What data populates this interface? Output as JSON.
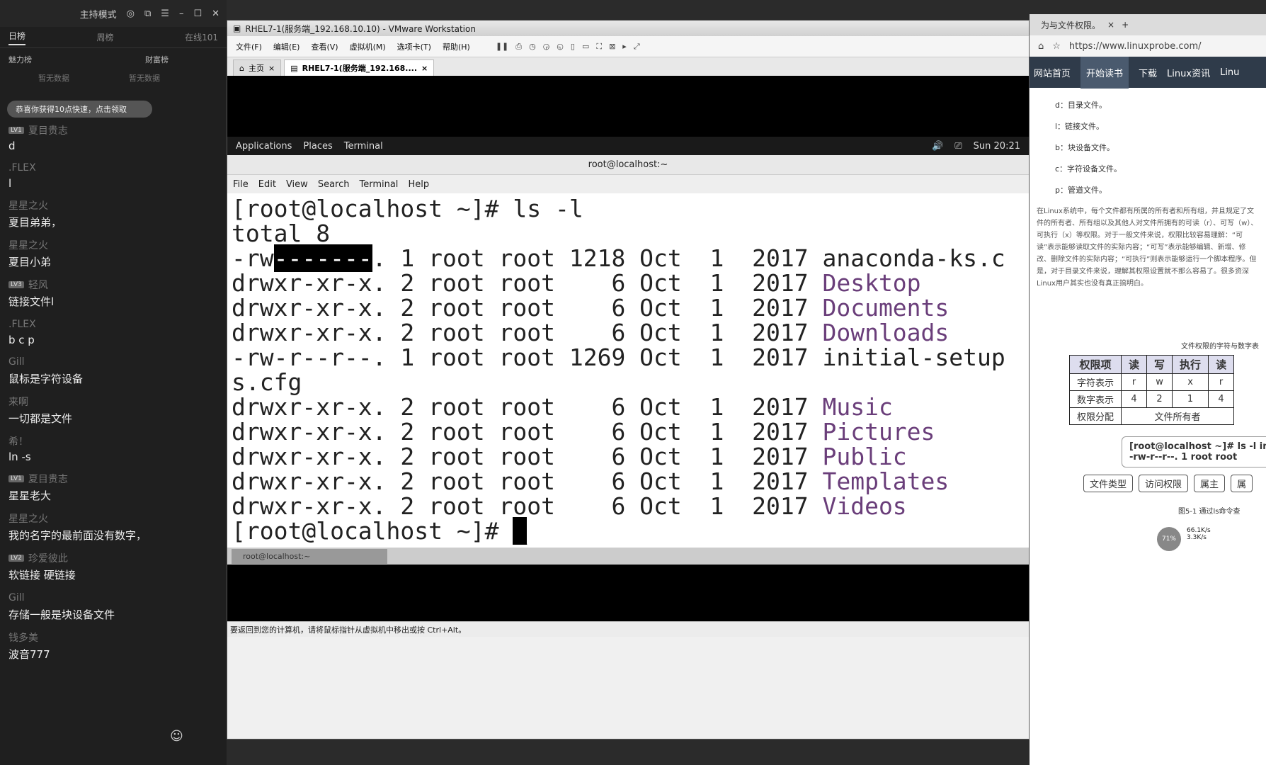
{
  "left_panel": {
    "mode": "主持模式",
    "tabs": [
      "日榜",
      "周榜",
      "在线101"
    ],
    "ranks": [
      "魅力榜",
      "财富榜"
    ],
    "empty": [
      "暂无数据",
      "暂无数据"
    ],
    "banner": "恭喜你获得10点快速，点击领取",
    "messages": [
      {
        "user": "夏目贵志",
        "level": "LV1",
        "text": "d"
      },
      {
        "user": ".FLEX",
        "level": "",
        "text": "l"
      },
      {
        "user": "星星之火",
        "level": "",
        "text": "夏目弟弟，"
      },
      {
        "user": "星星之火",
        "level": "",
        "text": "夏目小弟"
      },
      {
        "user": "轻风",
        "level": "LV3",
        "text": "链接文件l"
      },
      {
        "user": ".FLEX",
        "level": "",
        "text": "b c p"
      },
      {
        "user": "Gill",
        "level": "",
        "text": "鼠标是字符设备"
      },
      {
        "user": "来啊",
        "level": "",
        "text": "一切都是文件"
      },
      {
        "user": "希！",
        "level": "",
        "text": "ln -s"
      },
      {
        "user": "夏目贵志",
        "level": "LV1",
        "text": "星星老大"
      },
      {
        "user": "星星之火",
        "level": "",
        "text": "我的名字的最前面没有数字，"
      },
      {
        "user": "珍爱彼此",
        "level": "LV2",
        "text": "软链接   硬链接"
      },
      {
        "user": "Gill",
        "level": "",
        "text": "存储一般是块设备文件"
      },
      {
        "user": "钱多美",
        "level": "",
        "text": "波音777"
      }
    ]
  },
  "vm": {
    "title": "RHEL7-1(服务端_192.168.10.10) - VMware Workstation",
    "menu": [
      "文件(F)",
      "编辑(E)",
      "查看(V)",
      "虚拟机(M)",
      "选项卡(T)",
      "帮助(H)"
    ],
    "tabs": [
      "主页",
      "RHEL7-1(服务端_192.168...."
    ],
    "gnome": {
      "applications": "Applications",
      "places": "Places",
      "terminal": "Terminal",
      "clock": "Sun 20:21"
    },
    "term_title": "root@localhost:~",
    "term_menu": [
      "File",
      "Edit",
      "View",
      "Search",
      "Terminal",
      "Help"
    ],
    "taskbar": "root@localhost:~",
    "status": "要返回到您的计算机，请将鼠标指针从虚拟机中移出或按 Ctrl+Alt。"
  },
  "terminal": {
    "cmd": "[root@localhost ~]# ls -l",
    "total": "total 8",
    "rows": [
      {
        "perm_a": "-rw",
        "perm_sel": "-------",
        "perm_b": ".",
        "rest": " 1 root root 1218 Oct  1  2017 ",
        "name": "anaconda-ks.c",
        "dir": false
      },
      {
        "perm_a": "drwxr-xr-x",
        "perm_sel": "",
        "perm_b": ".",
        "rest": " 2 root root    6 Oct  1  2017 ",
        "name": "Desktop",
        "dir": true
      },
      {
        "perm_a": "drwxr-xr-x",
        "perm_sel": "",
        "perm_b": ".",
        "rest": " 2 root root    6 Oct  1  2017 ",
        "name": "Documents",
        "dir": true
      },
      {
        "perm_a": "drwxr-xr-x",
        "perm_sel": "",
        "perm_b": ".",
        "rest": " 2 root root    6 Oct  1  2017 ",
        "name": "Downloads",
        "dir": true
      },
      {
        "perm_a": "-rw-r--r--",
        "perm_sel": "",
        "perm_b": ".",
        "rest": " 1 root root 1269 Oct  1  2017 ",
        "name": "initial-setup",
        "dir": false
      },
      {
        "perm_a": "",
        "perm_sel": "",
        "perm_b": "",
        "rest": "",
        "name": "s.cfg",
        "dir": false
      },
      {
        "perm_a": "drwxr-xr-x",
        "perm_sel": "",
        "perm_b": ".",
        "rest": " 2 root root    6 Oct  1  2017 ",
        "name": "Music",
        "dir": true
      },
      {
        "perm_a": "drwxr-xr-x",
        "perm_sel": "",
        "perm_b": ".",
        "rest": " 2 root root    6 Oct  1  2017 ",
        "name": "Pictures",
        "dir": true
      },
      {
        "perm_a": "drwxr-xr-x",
        "perm_sel": "",
        "perm_b": ".",
        "rest": " 2 root root    6 Oct  1  2017 ",
        "name": "Public",
        "dir": true
      },
      {
        "perm_a": "drwxr-xr-x",
        "perm_sel": "",
        "perm_b": ".",
        "rest": " 2 root root    6 Oct  1  2017 ",
        "name": "Templates",
        "dir": true
      },
      {
        "perm_a": "drwxr-xr-x",
        "perm_sel": "",
        "perm_b": ".",
        "rest": " 2 root root    6 Oct  1  2017 ",
        "name": "Videos",
        "dir": true
      }
    ],
    "prompt": "[root@localhost ~]# "
  },
  "browser": {
    "tab": "为与文件权限。",
    "url": "https://www.linuxprobe.com/",
    "nav": [
      "网站首页",
      "开始读书",
      "下载",
      "Linux资讯",
      "Linu"
    ],
    "list": [
      "d：目录文件。",
      "l：链接文件。",
      "b：块设备文件。",
      "c：字符设备文件。",
      "p：管道文件。"
    ],
    "para1": "在Linux系统中，每个文件都有所属的所有者和所有组，并且规定了文件的所有者、所有组以及其他人对文件所拥有的可读（r）、可写（w）、可执行（x）等权限。对于一般文件来说，权限比较容易理解：“可读”表示能够读取文件的实际内容；“可写”表示能够编辑、新增、修改、删除文件的实际内容；“可执行”则表示能够运行一个脚本程序。但是，对于目录文件来说，理解其权限设置就不那么容易了。很多资深Linux用户其实也没有真正搞明白。",
    "caption": "文件权限的字符与数字表",
    "table": [
      [
        "权限项",
        "读",
        "写",
        "执行",
        "读"
      ],
      [
        "字符表示",
        "r",
        "w",
        "x",
        "r"
      ],
      [
        "数字表示",
        "4",
        "2",
        "1",
        "4"
      ],
      [
        "权限分配",
        "文件所有者",
        "",
        "",
        ""
      ]
    ],
    "fig_line1": "[root@localhost ~]# ls -l in",
    "fig_line2": "-rw-r--r--.  1   root   root",
    "fig_labels": [
      "文件类型",
      "访问权限",
      "属主",
      "属"
    ],
    "fig_caption": "图5-1 通过ls命令查",
    "speed_up": "66.1K/s",
    "speed_down": "3.3K/s",
    "cpu": "71%"
  }
}
